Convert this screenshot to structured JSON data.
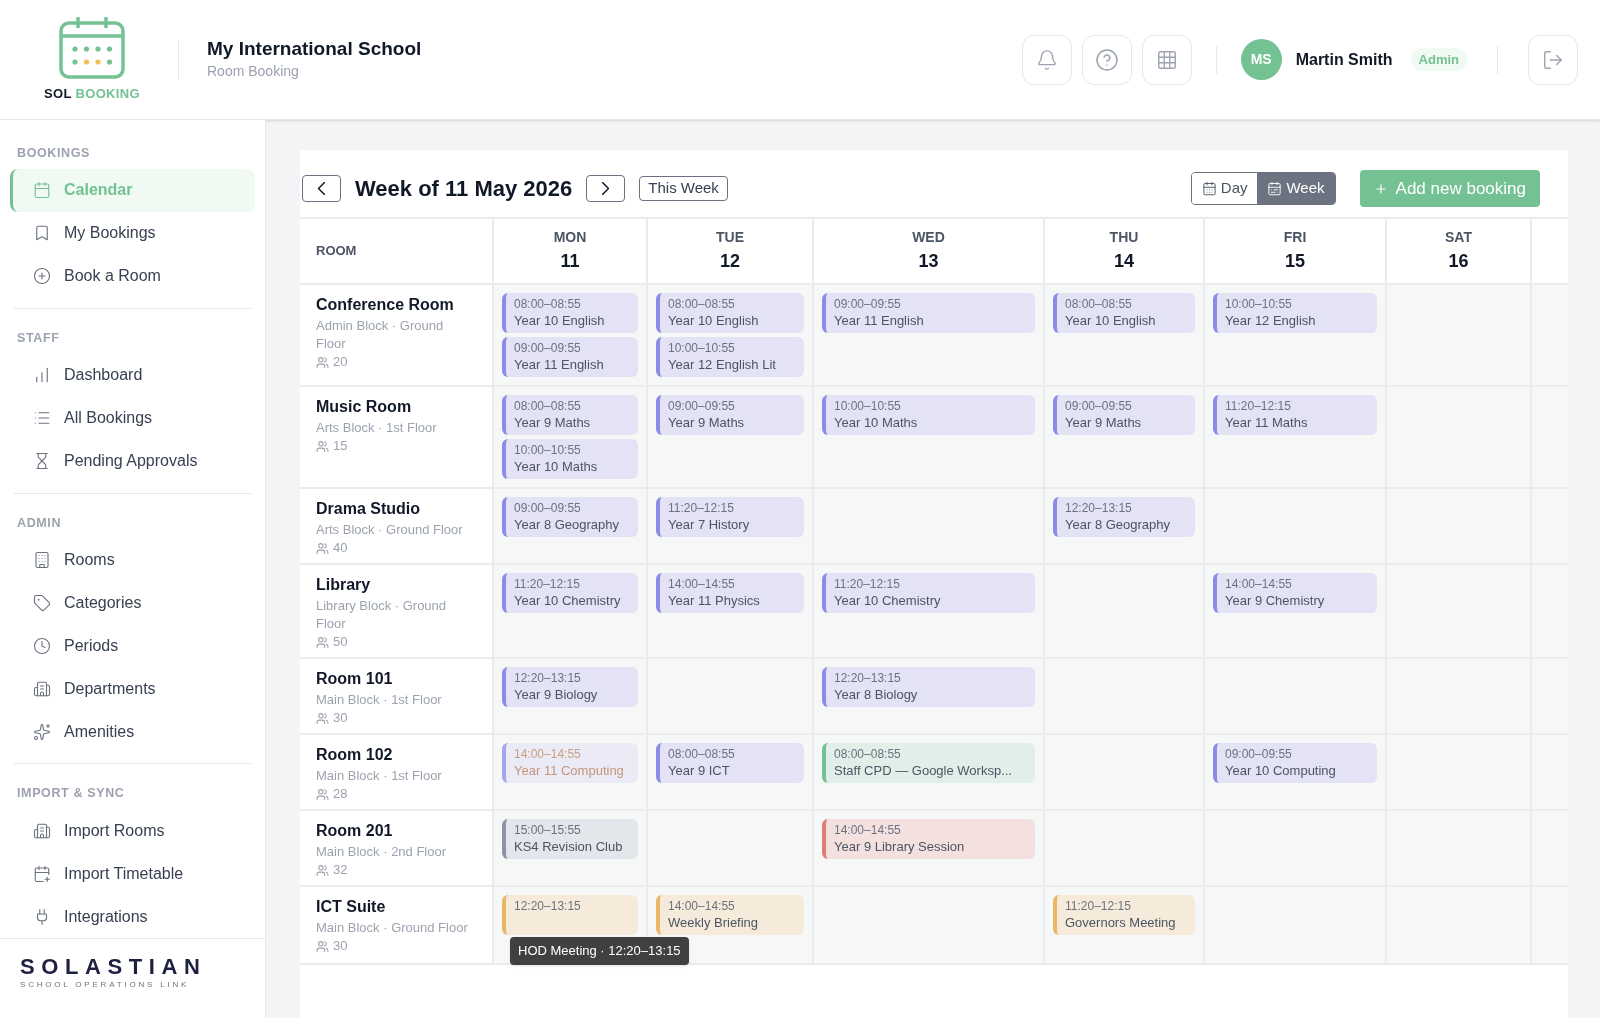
{
  "brand": {
    "logo_left": "SOL",
    "logo_right": "BOOKING"
  },
  "school": {
    "name": "My International School",
    "subtitle": "Room Booking"
  },
  "user": {
    "initials": "MS",
    "name": "Martin Smith",
    "role": "Admin"
  },
  "sidebar": {
    "sections": [
      {
        "title": "BOOKINGS",
        "items": [
          {
            "label": "Calendar",
            "selected": true
          },
          {
            "label": "My Bookings",
            "selected": false
          },
          {
            "label": "Book a Room",
            "selected": false
          }
        ]
      },
      {
        "title": "STAFF",
        "items": [
          {
            "label": "Dashboard",
            "selected": false
          },
          {
            "label": "All Bookings",
            "selected": false
          },
          {
            "label": "Pending Approvals",
            "selected": false
          }
        ]
      },
      {
        "title": "ADMIN",
        "items": [
          {
            "label": "Rooms",
            "selected": false
          },
          {
            "label": "Categories",
            "selected": false
          },
          {
            "label": "Periods",
            "selected": false
          },
          {
            "label": "Departments",
            "selected": false
          },
          {
            "label": "Amenities",
            "selected": false
          }
        ]
      },
      {
        "title": "IMPORT & SYNC",
        "items": [
          {
            "label": "Import Rooms",
            "selected": false
          },
          {
            "label": "Import Timetable",
            "selected": false
          },
          {
            "label": "Integrations",
            "selected": false
          }
        ]
      }
    ],
    "footer": {
      "logo": "SOLASTIAN",
      "tagline": "SCHOOL OPERATIONS LINK"
    }
  },
  "toolbar": {
    "title": "Week of 11 May 2026",
    "today_button": "This Week",
    "views": [
      {
        "label": "Day",
        "selected": false
      },
      {
        "label": "Week",
        "selected": true
      }
    ],
    "add_button": "Add new booking"
  },
  "table": {
    "room_header": "ROOM",
    "days": [
      {
        "dow": "MON",
        "date": "11"
      },
      {
        "dow": "TUE",
        "date": "12"
      },
      {
        "dow": "WED",
        "date": "13"
      },
      {
        "dow": "THU",
        "date": "14"
      },
      {
        "dow": "FRI",
        "date": "15"
      },
      {
        "dow": "SAT",
        "date": "16"
      }
    ],
    "rows": [
      {
        "room": "Conference Room",
        "location": "Admin Block · Ground Floor",
        "capacity": "20",
        "cells": [
          [
            {
              "kind": "lesson",
              "time": "08:00–08:55",
              "title": "Year 10 English"
            },
            {
              "kind": "lesson",
              "time": "09:00–09:55",
              "title": "Year 11 English"
            }
          ],
          [
            {
              "kind": "lesson",
              "time": "08:00–08:55",
              "title": "Year 10 English"
            },
            {
              "kind": "lesson",
              "time": "10:00–10:55",
              "title": "Year 12 English Lit"
            }
          ],
          [
            {
              "kind": "lesson",
              "time": "09:00–09:55",
              "title": "Year 11 English"
            }
          ],
          [
            {
              "kind": "lesson",
              "time": "08:00–08:55",
              "title": "Year 10 English"
            }
          ],
          [
            {
              "kind": "lesson",
              "time": "10:00–10:55",
              "title": "Year 12 English"
            }
          ],
          []
        ]
      },
      {
        "room": "Music Room",
        "location": "Arts Block · 1st Floor",
        "capacity": "15",
        "cells": [
          [
            {
              "kind": "lesson",
              "time": "08:00–08:55",
              "title": "Year 9 Maths"
            },
            {
              "kind": "lesson",
              "time": "10:00–10:55",
              "title": "Year 10 Maths"
            }
          ],
          [
            {
              "kind": "lesson",
              "time": "09:00–09:55",
              "title": "Year 9 Maths"
            }
          ],
          [
            {
              "kind": "lesson",
              "time": "10:00–10:55",
              "title": "Year 10 Maths"
            }
          ],
          [
            {
              "kind": "lesson",
              "time": "09:00–09:55",
              "title": "Year 9 Maths"
            }
          ],
          [
            {
              "kind": "lesson",
              "time": "11:20–12:15",
              "title": "Year 11 Maths"
            }
          ],
          []
        ]
      },
      {
        "room": "Drama Studio",
        "location": "Arts Block · Ground Floor",
        "capacity": "40",
        "cells": [
          [
            {
              "kind": "lesson",
              "time": "09:00–09:55",
              "title": "Year 8 Geography"
            }
          ],
          [
            {
              "kind": "lesson",
              "time": "11:20–12:15",
              "title": "Year 7 History"
            }
          ],
          [],
          [
            {
              "kind": "lesson",
              "time": "12:20–13:15",
              "title": "Year 8 Geography"
            }
          ],
          [],
          []
        ]
      },
      {
        "room": "Library",
        "location": "Library Block · Ground Floor",
        "capacity": "50",
        "cells": [
          [
            {
              "kind": "lesson",
              "time": "11:20–12:15",
              "title": "Year 10 Chemistry"
            }
          ],
          [
            {
              "kind": "lesson",
              "time": "14:00–14:55",
              "title": "Year 11 Physics"
            }
          ],
          [
            {
              "kind": "lesson",
              "time": "11:20–12:15",
              "title": "Year 10 Chemistry"
            }
          ],
          [],
          [
            {
              "kind": "lesson",
              "time": "14:00–14:55",
              "title": "Year 9 Chemistry"
            }
          ],
          []
        ]
      },
      {
        "room": "Room 101",
        "location": "Main Block · 1st Floor",
        "capacity": "30",
        "cells": [
          [
            {
              "kind": "lesson",
              "time": "12:20–13:15",
              "title": "Year 9 Biology"
            }
          ],
          [],
          [
            {
              "kind": "lesson",
              "time": "12:20–13:15",
              "title": "Year 8 Biology"
            }
          ],
          [],
          [],
          []
        ]
      },
      {
        "room": "Room 102",
        "location": "Main Block · 1st Floor",
        "capacity": "28",
        "cells": [
          [
            {
              "kind": "pending",
              "time": "14:00–14:55",
              "title": "Year 11 Computing"
            }
          ],
          [
            {
              "kind": "lesson",
              "time": "08:00–08:55",
              "title": "Year 9 ICT"
            }
          ],
          [
            {
              "kind": "staff",
              "time": "08:00–08:55",
              "title": "Staff CPD — Google Worksp..."
            }
          ],
          [],
          [
            {
              "kind": "lesson",
              "time": "09:00–09:55",
              "title": "Year 10 Computing"
            }
          ],
          []
        ]
      },
      {
        "room": "Room 201",
        "location": "Main Block · 2nd Floor",
        "capacity": "32",
        "cells": [
          [
            {
              "kind": "club",
              "time": "15:00–15:55",
              "title": "KS4 Revision Club"
            }
          ],
          [],
          [
            {
              "kind": "event",
              "time": "14:00–14:55",
              "title": "Year 9 Library Session"
            }
          ],
          [],
          [],
          []
        ]
      },
      {
        "room": "ICT Suite",
        "location": "Main Block · Ground Floor",
        "capacity": "30",
        "cells": [
          [
            {
              "kind": "meeting",
              "time": "12:20–13:15",
              "tooltip": "HOD Meeting · 12:20–13:15"
            }
          ],
          [
            {
              "kind": "meeting",
              "time": "14:00–14:55",
              "title": "Weekly Briefing"
            }
          ],
          [],
          [
            {
              "kind": "meeting",
              "time": "11:20–12:15",
              "title": "Governors Meeting"
            }
          ],
          [],
          []
        ]
      }
    ]
  }
}
